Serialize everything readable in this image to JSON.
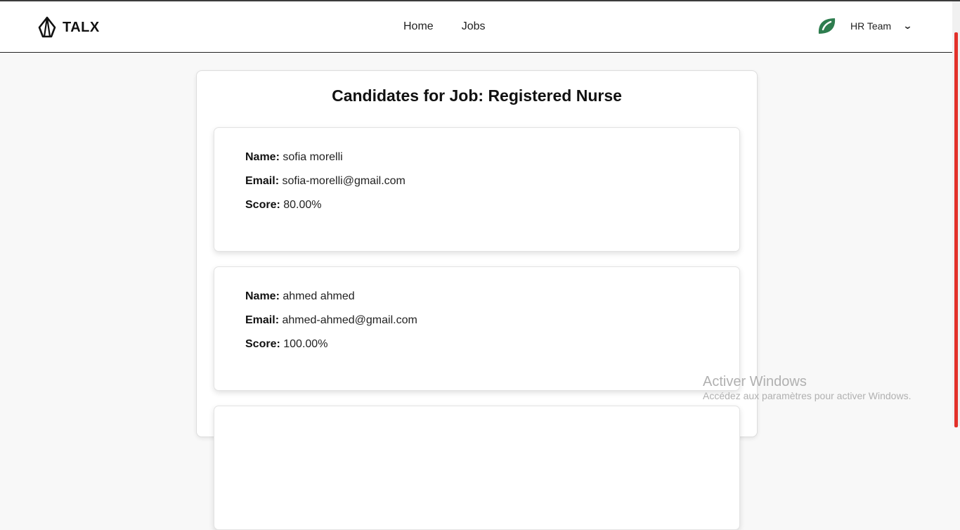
{
  "brand": {
    "name": "TALX",
    "logo_icon": "talx-logo-icon"
  },
  "nav": {
    "items": [
      {
        "label": "Home"
      },
      {
        "label": "Jobs"
      }
    ]
  },
  "user": {
    "name": "HR Team",
    "avatar_icon": "leaf-avatar-icon",
    "menu_icon": "chevron-down-icon",
    "avatar_color": "#2e7d4f"
  },
  "page": {
    "title": "Candidates for Job: Registered Nurse"
  },
  "labels": {
    "name": "Name:",
    "email": "Email:",
    "score": "Score:"
  },
  "candidates": [
    {
      "name": "sofia morelli",
      "email": "sofia-morelli@gmail.com",
      "score": "80.00%"
    },
    {
      "name": "ahmed ahmed",
      "email": "ahmed-ahmed@gmail.com",
      "score": "100.00%"
    }
  ],
  "watermark": {
    "title": "Activer Windows",
    "subtitle": "Accédez aux paramètres pour activer Windows."
  },
  "colors": {
    "scrollbar_thumb": "#e2312a",
    "page_bg": "#f8f8f8",
    "card_bg": "#ffffff"
  }
}
